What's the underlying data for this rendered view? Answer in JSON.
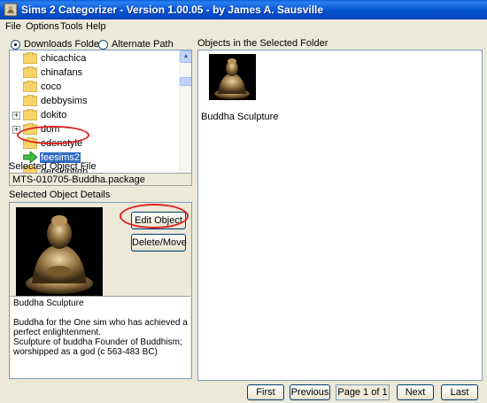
{
  "window": {
    "title": "Sims 2 Categorizer - Version 1.00.05 - by James A. Sausville"
  },
  "menu": [
    "File",
    "Options",
    "Tools",
    "Help"
  ],
  "source": {
    "downloads_label": "Downloads Folder",
    "alternate_label": "Alternate Path",
    "selected": "Downloads Folder"
  },
  "tree": {
    "items": [
      {
        "label": "chicachica",
        "expandable": false,
        "selected": false
      },
      {
        "label": "chinafans",
        "expandable": false,
        "selected": false
      },
      {
        "label": "coco",
        "expandable": false,
        "selected": false
      },
      {
        "label": "debbysims",
        "expandable": false,
        "selected": false
      },
      {
        "label": "dokito",
        "expandable": true,
        "selected": false
      },
      {
        "label": "dom",
        "expandable": true,
        "selected": false
      },
      {
        "label": "edenstyle",
        "expandable": false,
        "selected": false
      },
      {
        "label": "feesims2",
        "expandable": false,
        "selected": true
      },
      {
        "label": "gerskintigh",
        "expandable": false,
        "selected": false
      }
    ]
  },
  "selected_file": {
    "label": "Selected Object File",
    "value": "MTS-010705-Buddha.package"
  },
  "details": {
    "label": "Selected Object Details",
    "edit_button": "Edit Object",
    "delete_button": "Delete/Move",
    "name": "Buddha Sculpture",
    "description_lines": [
      "Buddha for the One sim who has achieved a state of",
      "perfect enlightenment.",
      "Sculpture of buddha Founder of Buddhism;",
      "worshipped as a god (c 563-483 BC)"
    ]
  },
  "objects": {
    "label": "Objects in the Selected Folder",
    "items": [
      {
        "label": "Buddha Sculpture"
      }
    ]
  },
  "pager": {
    "first": "First",
    "previous": "Previous",
    "page": "Page 1 of 1",
    "next": "Next",
    "last": "Last"
  },
  "colors": {
    "titlebar": "#0857d6",
    "selection": "#316ac5",
    "annotation": "#e02020",
    "window_bg": "#ece9d8"
  },
  "icons": {
    "app": "sims-app-icon",
    "folder": "folder-icon",
    "selected_folder": "green-arrow-icon"
  }
}
